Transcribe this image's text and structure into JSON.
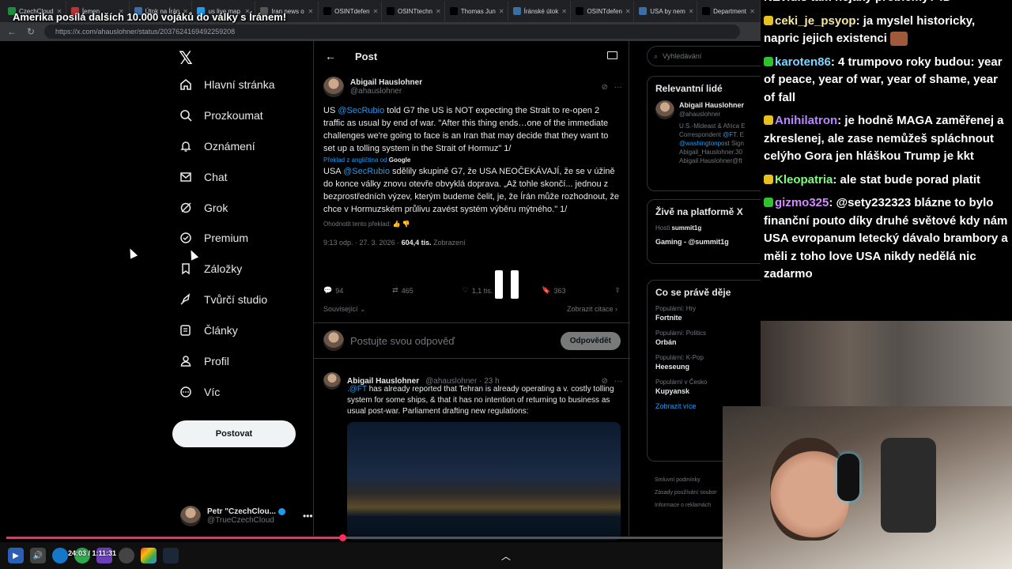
{
  "overlay_title": "Amerika posílá dalších 10.000 vojáků do války s Íránem!",
  "browser": {
    "tabs": [
      {
        "label": "CzechCloud",
        "color": "#1a8f3a"
      },
      {
        "label": "Íemen",
        "color": "#b33"
      },
      {
        "label": "Útok na Írán",
        "color": "#3a6ea5"
      },
      {
        "label": "us live map",
        "color": "#1d9bf0"
      },
      {
        "label": "Iran news o",
        "color": "#555"
      },
      {
        "label": "OSINTdefen",
        "color": "#000"
      },
      {
        "label": "OSINTtechn",
        "color": "#000"
      },
      {
        "label": "Thomas Jun",
        "color": "#000"
      },
      {
        "label": "Íránské útok",
        "color": "#3a6ea5"
      },
      {
        "label": "OSINTdefen",
        "color": "#000"
      },
      {
        "label": "USA by nem",
        "color": "#3a6ea5"
      },
      {
        "label": "Department",
        "color": "#000"
      }
    ],
    "url": "https://x.com/ahauslohner/status/2037624169492259208"
  },
  "nav": {
    "logo": "𝕏",
    "items": [
      {
        "label": "Hlavní stránka",
        "icon": "home-icon"
      },
      {
        "label": "Prozkoumat",
        "icon": "search-icon"
      },
      {
        "label": "Oznámení",
        "icon": "bell-icon"
      },
      {
        "label": "Chat",
        "icon": "mail-icon"
      },
      {
        "label": "Grok",
        "icon": "grok-icon"
      },
      {
        "label": "Premium",
        "icon": "premium-icon"
      },
      {
        "label": "Záložky",
        "icon": "bookmark-icon"
      },
      {
        "label": "Tvůrčí studio",
        "icon": "rocket-icon"
      },
      {
        "label": "Články",
        "icon": "article-icon"
      },
      {
        "label": "Profil",
        "icon": "person-icon"
      },
      {
        "label": "Víc",
        "icon": "more-icon"
      }
    ],
    "post_button": "Postovat",
    "profile_name": "Petr \"CzechClou...",
    "profile_handle": "@TrueCzechCloud"
  },
  "post": {
    "header": "Post",
    "author_name": "Abigail Hauslohner",
    "author_handle": "@ahauslohner",
    "text_before": "US ",
    "mention": "@SecRubio",
    "text_after": " told G7 the US is NOT expecting the Strait to re-open 2 traffic as usual by end of war. \"After this thing ends…one of the immediate challenges we're going to face is an Iran that may decide that they want to set up a tolling system in the Strait of Hormuz\" 1/",
    "translated_label": "Překlad z angličtina od",
    "translated_brand": "Google",
    "cz_before": "USA ",
    "cz_mention": "@SecRubio",
    "cz_after": " sdělily skupině G7, že USA NEOČEKÁVAJÍ, že se v úžině do konce války znovu otevře obvyklá doprava. „Až tohle skončí... jednou z bezprostředních výzev, kterým budeme čelit, je, že Írán může rozhodnout, že chce v Hormuzském průlivu zavést systém výběru mýtného.\" 1/",
    "rate": "Ohodnotit tento překlad:",
    "time": "9:13 odp. · 27. 3. 2026",
    "views": "604,4 tis.",
    "views_label": "Zobrazení",
    "replies": "94",
    "reposts": "465",
    "likes": "1,1 tis.",
    "bookmarks": "363",
    "related": "Související",
    "show_quotes": "Zobrazit citace",
    "reply_placeholder": "Postujte svou odpověď",
    "reply_button": "Odpovědět"
  },
  "post2": {
    "author_name": "Abigail Hauslohner",
    "author_handle": "@ahauslohner · 23 h",
    "mention": ".@FT",
    "text": " has already reported that Tehran is already operating a v. costly tolling system for some ships, & that it has no intention of returning to business as usual post-war. Parliament drafting new regulations:"
  },
  "right": {
    "search_placeholder": "Vyhledávání",
    "relevant_title": "Relevantní lidé",
    "person_name": "Abigail Hauslohner",
    "person_handle": "@ahauslohner",
    "person_bio1": "U.S.-Mideast & Africa E",
    "person_bio2": "Correspondent ",
    "person_bio2_link": "@FT",
    "person_bio2_rest": ". E",
    "person_bio3": "@washingtonpost",
    "person_bio3_rest": " Sign",
    "person_bio4": "Abigail_Hauslohner.30",
    "person_bio5": "Abigail.Hauslohner@ft",
    "live_title": "Živě na platformě X",
    "live_host": "Hosti",
    "live_name": "summit1g",
    "live_game": "Gaming - @summit1g",
    "happen_title": "Co se právě děje",
    "trends": [
      {
        "cat": "Populární: Hry",
        "name": "Fortnite"
      },
      {
        "cat": "Populární: Politics",
        "name": "Orbán"
      },
      {
        "cat": "Populární: K-Pop",
        "name": "Heeseung"
      },
      {
        "cat": "Populární v Česko",
        "name": "Kupyansk"
      }
    ],
    "show_more": "Zobrazit více",
    "footer1": "Smluvní podmínky",
    "footer2": "Zásady používání soubor",
    "footer3": "Informace o reklamách"
  },
  "player": {
    "time": "24:03 / 1:11:31",
    "progress": 0.446
  },
  "chat": [
    {
      "badge": "",
      "nick": "",
      "nick_color": "#fff",
      "text": "NEvidis tam nejaky problemy? :D"
    },
    {
      "badge": "#e8c020",
      "nick": "ceki_je_psyop",
      "nick_color": "#f5e6a0",
      "text": ": ja myslel historicky, napric jejich existenci"
    },
    {
      "badge": "#2fc22f",
      "nick": "karoten86",
      "nick_color": "#7ad7ff",
      "text": ": 4 trumpovo roky budou: year of peace, year of war, year of shame, year of fall"
    },
    {
      "badge": "#e8c020",
      "nick": "Anihilatron",
      "nick_color": "#b987ff",
      "text": ": je hodně MAGA zaměřenej a zkreslenej, ale zase nemůžeš spláchnout celýho Gora jen hláškou Trump je kkt"
    },
    {
      "badge": "#e8c020",
      "nick": "Kleopatria",
      "nick_color": "#7bff7b",
      "text": ": ale stat bude porad platit"
    },
    {
      "badge": "#2fc22f",
      "nick": "gizmo325",
      "nick_color": "#d28cff",
      "text": ": @sety232323 blázne to bylo finanční pouto díky druhé světové kdy nám USA evropanum letecký dávalo brambory a měli z toho love USA nikdy nedělá nic zadarmo"
    }
  ]
}
